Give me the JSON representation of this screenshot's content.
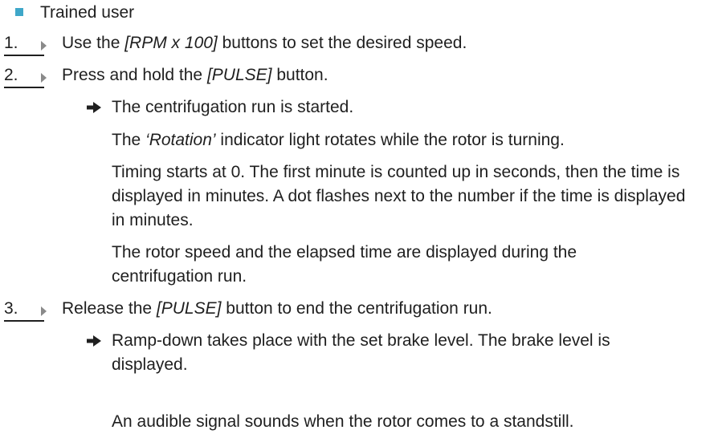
{
  "requirement": "Trained user",
  "steps": [
    {
      "number": "1.",
      "before": "Use the ",
      "em": "[RPM x 100]",
      "after": " buttons to set the desired speed."
    },
    {
      "number": "2.",
      "before": "Press and hold the ",
      "em": "[PULSE]",
      "after": " button."
    },
    {
      "number": "3.",
      "before": "Release the ",
      "em": "[PULSE]",
      "after": " button to end the centrifugation run."
    }
  ],
  "step2_result": "The centrifugation run is started.",
  "step2_notes": {
    "rotation_before": "The ",
    "rotation_em": "‘Rotation’",
    "rotation_after": " indicator light rotates while the rotor is turning.",
    "timing": "Timing starts at 0. The first minute is counted up in seconds, then the time is displayed in minutes. A dot flashes next to the number if the time is displayed in minutes.",
    "speed": "The rotor speed and the elapsed time are displayed during the centrifugation run."
  },
  "step3_result": "Ramp-down takes place with the set brake level. The brake level is displayed.",
  "step3_note": "An audible signal sounds when the rotor comes to a standstill.",
  "colors": {
    "bullet": "#3fa7c9",
    "text": "#1f1f1f",
    "step_arrow": "#8a8a8a"
  },
  "icons": {
    "requirement": "square-bullet-icon",
    "step": "triangle-arrow-icon",
    "result": "right-arrow-icon"
  }
}
